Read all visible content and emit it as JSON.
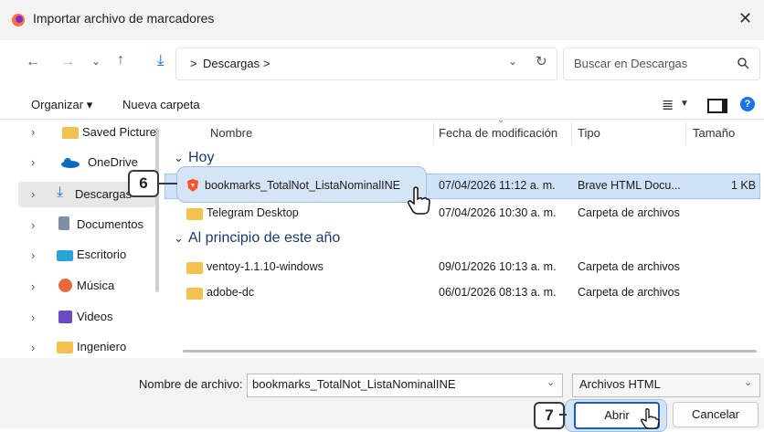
{
  "window": {
    "title": "Importar archivo de marcadores"
  },
  "address": {
    "crumb_root": ">",
    "crumb": "Descargas",
    "crumb_sep": ">"
  },
  "search": {
    "placeholder": "Buscar en Descargas"
  },
  "toolbar": {
    "organize_label": "Organizar ▾",
    "new_folder_label": "Nueva carpeta"
  },
  "sidebar": {
    "items": [
      {
        "label": "Saved Picture",
        "icon": "folder-icon"
      },
      {
        "label": "OneDrive",
        "icon": "cloud-icon"
      },
      {
        "label": "Descargas",
        "icon": "download-icon"
      },
      {
        "label": "Documentos",
        "icon": "document-icon"
      },
      {
        "label": "Escritorio",
        "icon": "desktop-icon"
      },
      {
        "label": "Música",
        "icon": "music-icon"
      },
      {
        "label": "Videos",
        "icon": "video-icon"
      },
      {
        "label": "Ingeniero",
        "icon": "folder-icon"
      }
    ]
  },
  "columns": {
    "name": "Nombre",
    "date": "Fecha de modificación",
    "type": "Tipo",
    "size": "Tamaño"
  },
  "groups": {
    "today": "Hoy",
    "early_year": "Al principio de este año"
  },
  "files": [
    {
      "name": "bookmarks_TotalNot_ListaNominalINE",
      "date": "07/04/2026 11:12 a. m.",
      "type": "Brave HTML Docu...",
      "size": "1 KB"
    },
    {
      "name": "Telegram Desktop",
      "date": "07/04/2026 10:30 a. m.",
      "type": "Carpeta de archivos",
      "size": ""
    },
    {
      "name": "ventoy-1.1.10-windows",
      "date": "09/01/2026 10:13 a. m.",
      "type": "Carpeta de archivos",
      "size": ""
    },
    {
      "name": "adobe-dc",
      "date": "06/01/2026 08:13 a. m.",
      "type": "Carpeta de archivos",
      "size": ""
    }
  ],
  "footer": {
    "filename_label": "Nombre de archivo:",
    "filename_value": "bookmarks_TotalNot_ListaNominalINE",
    "filetype_value": "Archivos HTML",
    "open_label": "Abrir",
    "cancel_label": "Cancelar"
  },
  "badges": {
    "step6": "6",
    "step7": "7"
  },
  "colors": {
    "selection": "#cfe2f7",
    "folder": "#f2c14e",
    "accent": "#1a73e8"
  }
}
